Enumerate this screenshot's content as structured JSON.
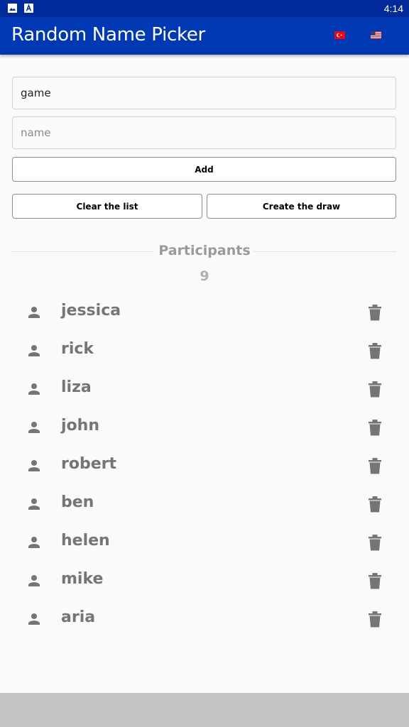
{
  "status_bar": {
    "time": "4:14",
    "icons": [
      "image-icon",
      "text-badge-icon"
    ]
  },
  "app_bar": {
    "title": "Random Name Picker",
    "language_flags": [
      "turkey-flag-icon",
      "usa-flag-icon"
    ]
  },
  "form": {
    "game_field": {
      "value": "game",
      "placeholder": ""
    },
    "name_field": {
      "value": "",
      "placeholder": "name"
    },
    "add_label": "Add",
    "clear_label": "Clear the list",
    "draw_label": "Create the draw"
  },
  "participants": {
    "title": "Participants",
    "count": "9",
    "items": [
      "jessica",
      "rick",
      "liza",
      "john",
      "robert",
      "ben",
      "helen",
      "mike",
      "aria"
    ]
  },
  "colors": {
    "status_bar": "#002a9a",
    "app_bar": "#0039b3",
    "background": "#fafafa",
    "list_text": "#757575",
    "icon": "#757575",
    "bottom_bar": "#c4c4c4"
  }
}
